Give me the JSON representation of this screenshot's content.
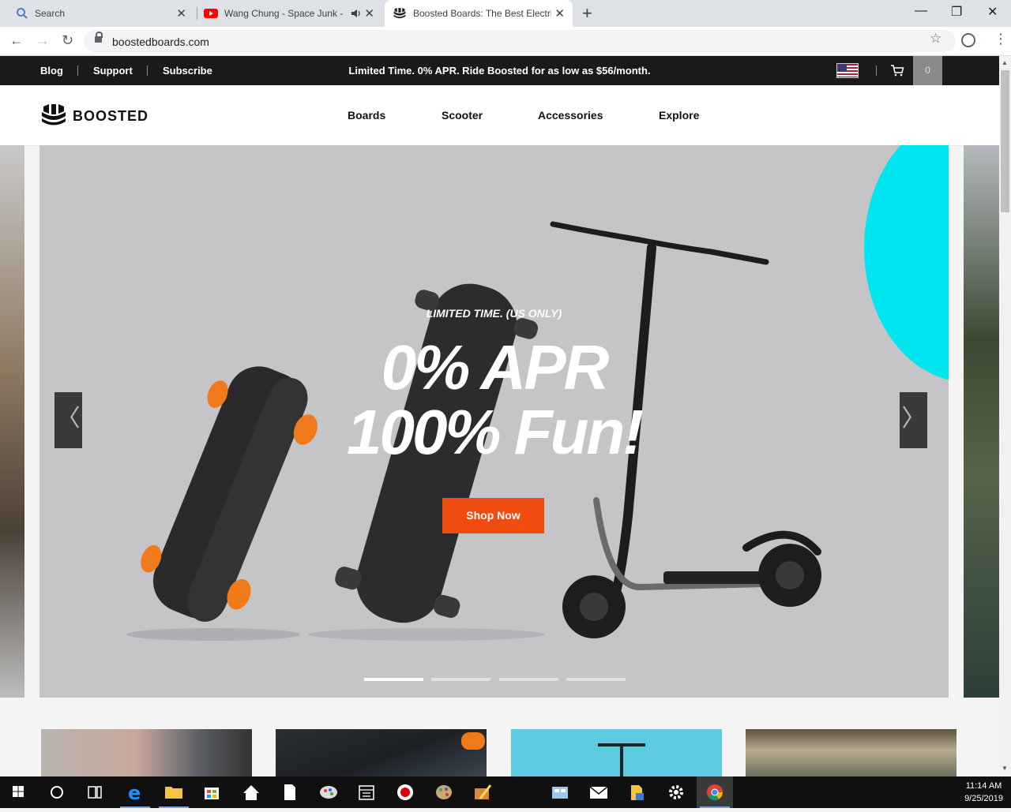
{
  "browser": {
    "tabs": [
      {
        "title": "Search",
        "icon": "search-icon"
      },
      {
        "title": "Wang Chung - Space Junk -",
        "icon": "youtube-icon",
        "audio": true
      },
      {
        "title": "Boosted Boards: The Best Electric",
        "icon": "boosted-favicon",
        "active": true
      }
    ],
    "new_tab": "+",
    "url": "boostedboards.com",
    "window_controls": {
      "minimize": "—",
      "maximize": "❐",
      "close": "✕"
    }
  },
  "topbar": {
    "links": [
      "Blog",
      "Support",
      "Subscribe"
    ],
    "promo": "Limited Time. 0% APR. Ride Boosted for as low as $56/month.",
    "cart_count": "0"
  },
  "header": {
    "logo": "BOOSTED",
    "nav": [
      "Boards",
      "Scooter",
      "Accessories",
      "Explore"
    ]
  },
  "hero": {
    "eyebrow": "LIMITED TIME. (US ONLY)",
    "line1": "0% APR",
    "line2": "100% Fun!",
    "cta": "Shop Now",
    "prev": "〈",
    "next": "〉",
    "slides": 4,
    "active_slide": 1,
    "accent_color": "#00e5f0",
    "cta_color": "#f04c0f"
  },
  "taskbar": {
    "time": "11:14 AM",
    "date": "9/25/2019"
  }
}
